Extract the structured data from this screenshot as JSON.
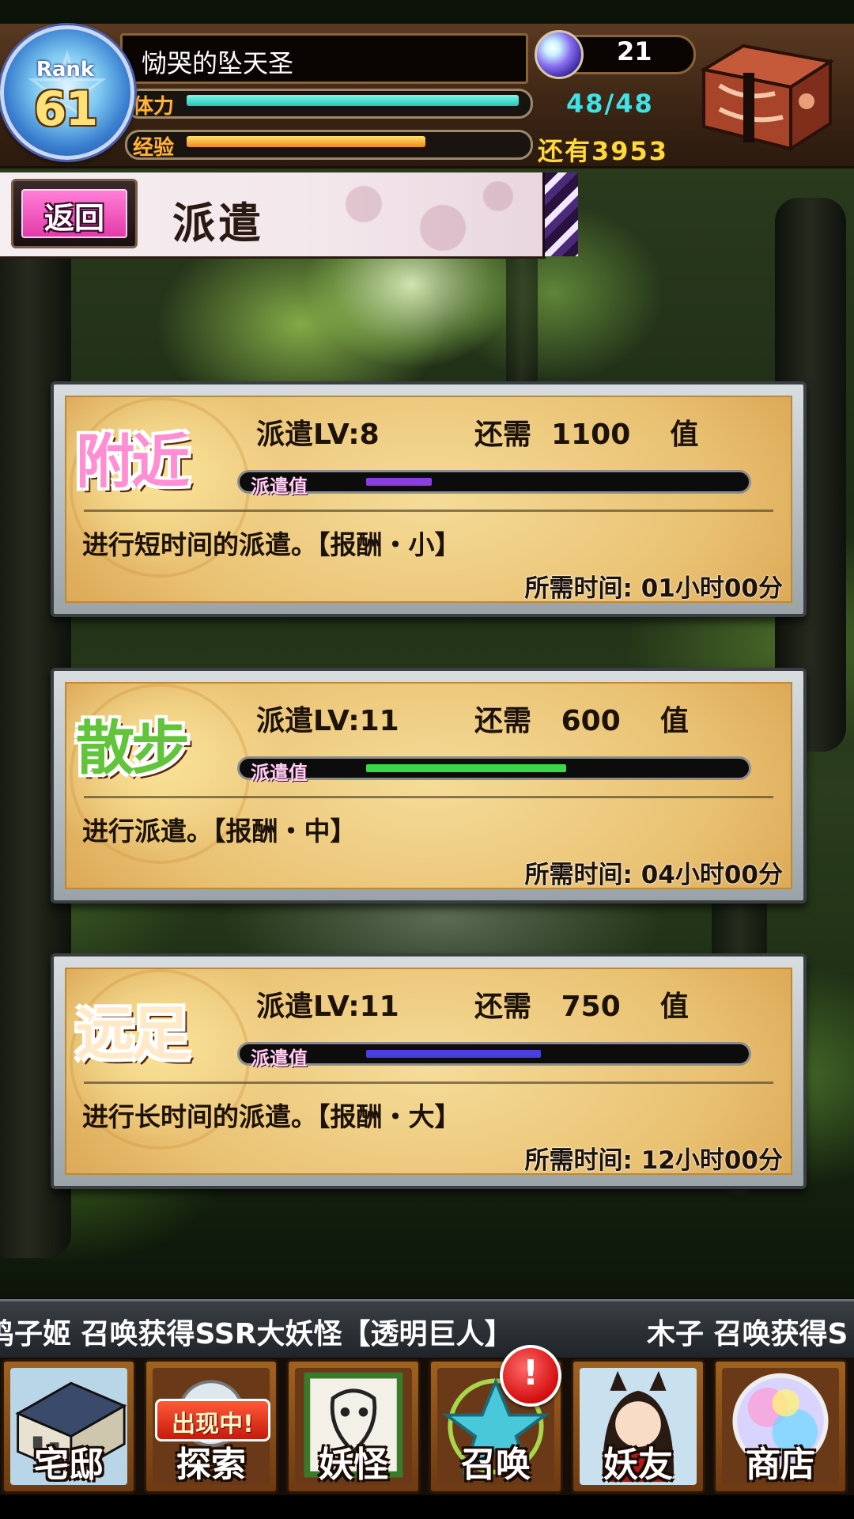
{
  "player": {
    "rank_label": "Rank",
    "rank": "61",
    "name": "恸哭的坠天圣",
    "orb_count": "21",
    "stamina_label": "体力",
    "stamina_value": "48/48",
    "stamina_fraction": 1.0,
    "exp_label": "经验",
    "exp_remaining": "还有3953",
    "exp_fraction": 0.72
  },
  "header": {
    "back_label": "返回",
    "title": "派遣"
  },
  "dispatch_cards": [
    {
      "category": "附近",
      "level": "派遣LV:8",
      "need": "还需  1100    值",
      "gauge_label": "派遣值",
      "gauge_fraction": 0.18,
      "gauge_color": "#8a3de0",
      "category_color": "#ff8fd2",
      "description": "进行短时间的派遣。【报酬・小】",
      "time": "所需时间: 01小时00分"
    },
    {
      "category": "散步",
      "level": "派遣LV:11",
      "need": "还需   600    值",
      "gauge_label": "派遣值",
      "gauge_fraction": 0.55,
      "gauge_color": "#39d84a",
      "category_color": "#62c43a",
      "description": "进行派遣。【报酬・中】",
      "time": "所需时间: 04小时00分"
    },
    {
      "category": "远足",
      "level": "派遣LV:11",
      "need": "还需   750    值",
      "gauge_label": "派遣值",
      "gauge_fraction": 0.48,
      "gauge_color": "#4a3ee0",
      "category_color": "#ffe9c8",
      "description": "进行长时间的派遣。【报酬・大】",
      "time": "所需时间: 12小时00分"
    }
  ],
  "ticker": {
    "message_1": "鸣子姬 召唤获得SSR大妖怪【透明巨人】",
    "message_2": "木子 召唤获得S"
  },
  "nav": {
    "items": [
      {
        "label": "宅邸",
        "icon": "house-icon"
      },
      {
        "label": "探索",
        "icon": "explore-icon"
      },
      {
        "label": "妖怪",
        "icon": "yokai-scroll-icon"
      },
      {
        "label": "召唤",
        "icon": "summon-star-icon"
      },
      {
        "label": "妖友",
        "icon": "friend-icon"
      },
      {
        "label": "商店",
        "icon": "shop-orb-icon"
      }
    ],
    "explore_tag": "出现中!",
    "summon_alert": "!"
  }
}
